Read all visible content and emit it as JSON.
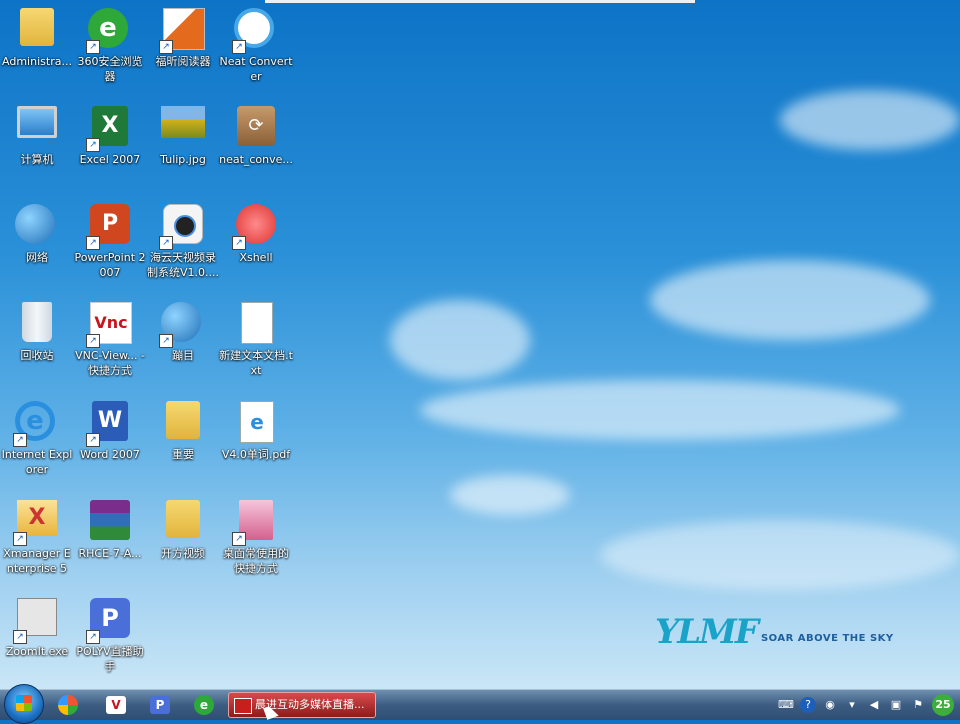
{
  "desktop": {
    "icons": [
      {
        "label": "Administra...",
        "icon": "user-folder-icon"
      },
      {
        "label": "360安全浏览器",
        "icon": "browser-360-icon"
      },
      {
        "label": "福昕阅读器",
        "icon": "foxit-reader-icon"
      },
      {
        "label": "Neat Converter",
        "icon": "neat-converter-icon"
      },
      {
        "label": "计算机",
        "icon": "computer-icon"
      },
      {
        "label": "Excel 2007",
        "icon": "excel-icon"
      },
      {
        "label": "Tulip.jpg",
        "icon": "image-file-icon"
      },
      {
        "label": "neat_conve...",
        "icon": "archive-icon"
      },
      {
        "label": "网络",
        "icon": "network-icon"
      },
      {
        "label": "PowerPoint 2007",
        "icon": "powerpoint-icon"
      },
      {
        "label": "海云天视频录制系统V1.0....",
        "icon": "camera-icon"
      },
      {
        "label": "Xshell",
        "icon": "xshell-icon"
      },
      {
        "label": "回收站",
        "icon": "recycle-bin-icon"
      },
      {
        "label": "VNC-View... - 快捷方式",
        "icon": "vnc-icon"
      },
      {
        "label": "蹦目",
        "icon": "blue-app-icon"
      },
      {
        "label": "新建文本文档.txt",
        "icon": "text-file-icon"
      },
      {
        "label": "Internet Explorer",
        "icon": "internet-explorer-icon"
      },
      {
        "label": "Word 2007",
        "icon": "word-icon"
      },
      {
        "label": "重要",
        "icon": "folder-icon"
      },
      {
        "label": "V4.0单词.pdf",
        "icon": "pdf-file-icon"
      },
      {
        "label": "Xmanager Enterprise 5",
        "icon": "xmanager-icon"
      },
      {
        "label": "RHCE-7-A...",
        "icon": "winrar-icon"
      },
      {
        "label": "开方视频",
        "icon": "folder-icon"
      },
      {
        "label": "桌面常使用的快捷方式",
        "icon": "shortcut-folder-icon"
      },
      {
        "label": "ZoomIt.exe",
        "icon": "zoomit-icon"
      },
      {
        "label": "POLYV直播助手",
        "icon": "polyv-icon"
      }
    ]
  },
  "branding": {
    "logo_text": "YLMF",
    "tagline": "SOAR ABOVE THE SKY"
  },
  "taskbar": {
    "active_task_label": "晨进互动多媒体直播...",
    "pinned": [
      "color-app-icon",
      "vnc-taskbar-icon",
      "polyv-taskbar-icon",
      "browser-360-taskbar-icon"
    ],
    "clock_badge": "25"
  },
  "colors": {
    "taskbar_active": "#b52a2a",
    "logo": "#1aa3c8"
  }
}
